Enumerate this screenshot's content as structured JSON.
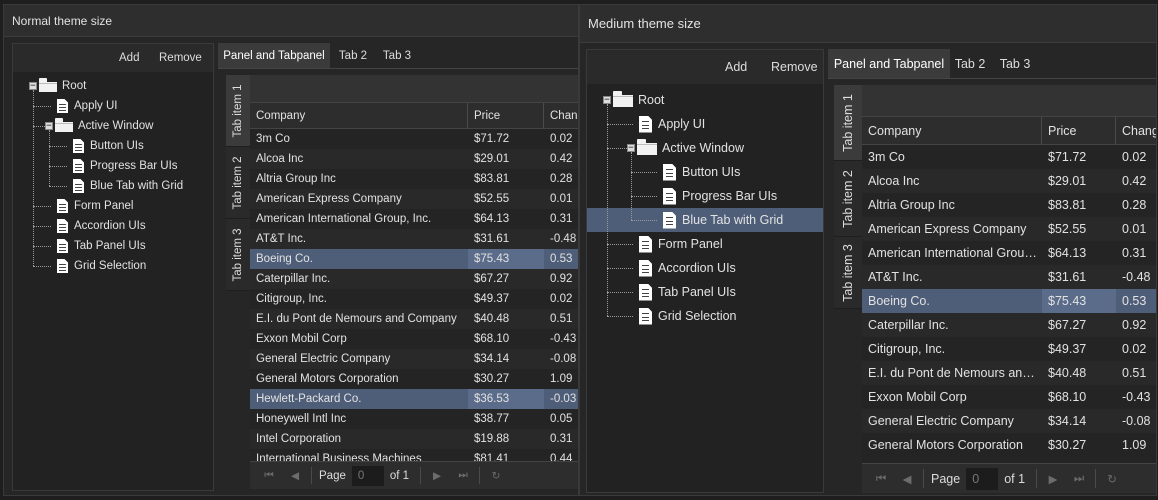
{
  "windows": [
    {
      "title": "Normal theme size",
      "toolbar": {
        "add_label": "Add",
        "remove_label": "Remove"
      },
      "tree": [
        {
          "label": "Root",
          "type": "folder",
          "depth": 0,
          "expanded": true
        },
        {
          "label": "Apply UI",
          "type": "doc",
          "depth": 1
        },
        {
          "label": "Active Window",
          "type": "folder",
          "depth": 1,
          "expanded": true
        },
        {
          "label": "Button UIs",
          "type": "doc",
          "depth": 2
        },
        {
          "label": "Progress Bar UIs",
          "type": "doc",
          "depth": 2
        },
        {
          "label": "Blue Tab with Grid",
          "type": "doc",
          "depth": 2
        },
        {
          "label": "Form Panel",
          "type": "doc",
          "depth": 1
        },
        {
          "label": "Accordion UIs",
          "type": "doc",
          "depth": 1
        },
        {
          "label": "Tab Panel UIs",
          "type": "doc",
          "depth": 1
        },
        {
          "label": "Grid Selection",
          "type": "doc",
          "depth": 1
        }
      ],
      "selected_tree_index": -1,
      "tabs": [
        "Panel and Tabpanel",
        "Tab 2",
        "Tab 3"
      ],
      "active_tab": 0,
      "vtabs": [
        "Tab item 1",
        "Tab item 2",
        "Tab item 3"
      ],
      "active_vtab": 0,
      "columns": [
        "Company",
        "Price",
        "Change"
      ],
      "rows": [
        [
          "3m Co",
          "$71.72",
          "0.02"
        ],
        [
          "Alcoa Inc",
          "$29.01",
          "0.42"
        ],
        [
          "Altria Group Inc",
          "$83.81",
          "0.28"
        ],
        [
          "American Express Company",
          "$52.55",
          "0.01"
        ],
        [
          "American International Group, Inc.",
          "$64.13",
          "0.31"
        ],
        [
          "AT&T Inc.",
          "$31.61",
          "-0.48"
        ],
        [
          "Boeing Co.",
          "$75.43",
          "0.53"
        ],
        [
          "Caterpillar Inc.",
          "$67.27",
          "0.92"
        ],
        [
          "Citigroup, Inc.",
          "$49.37",
          "0.02"
        ],
        [
          "E.I. du Pont de Nemours and Company",
          "$40.48",
          "0.51"
        ],
        [
          "Exxon Mobil Corp",
          "$68.10",
          "-0.43"
        ],
        [
          "General Electric Company",
          "$34.14",
          "-0.08"
        ],
        [
          "General Motors Corporation",
          "$30.27",
          "1.09"
        ],
        [
          "Hewlett-Packard Co.",
          "$36.53",
          "-0.03"
        ],
        [
          "Honeywell Intl Inc",
          "$38.77",
          "0.05"
        ],
        [
          "Intel Corporation",
          "$19.88",
          "0.31"
        ],
        [
          "International Business Machines",
          "$81.41",
          "0.44"
        ]
      ],
      "selected_rows": [
        6,
        13
      ],
      "pager": {
        "page_label": "Page",
        "page_value": "0",
        "of_label": "of 1"
      }
    },
    {
      "title": "Medium theme size",
      "toolbar": {
        "add_label": "Add",
        "remove_label": "Remove"
      },
      "tree": [
        {
          "label": "Root",
          "type": "folder",
          "depth": 0,
          "expanded": true
        },
        {
          "label": "Apply UI",
          "type": "doc",
          "depth": 1
        },
        {
          "label": "Active Window",
          "type": "folder",
          "depth": 1,
          "expanded": true
        },
        {
          "label": "Button UIs",
          "type": "doc",
          "depth": 2
        },
        {
          "label": "Progress Bar UIs",
          "type": "doc",
          "depth": 2
        },
        {
          "label": "Blue Tab with Grid",
          "type": "doc",
          "depth": 2
        },
        {
          "label": "Form Panel",
          "type": "doc",
          "depth": 1
        },
        {
          "label": "Accordion UIs",
          "type": "doc",
          "depth": 1
        },
        {
          "label": "Tab Panel UIs",
          "type": "doc",
          "depth": 1
        },
        {
          "label": "Grid Selection",
          "type": "doc",
          "depth": 1
        }
      ],
      "selected_tree_index": 5,
      "tabs": [
        "Panel and Tabpanel",
        "Tab 2",
        "Tab 3"
      ],
      "active_tab": 0,
      "vtabs": [
        "Tab item 1",
        "Tab item 2",
        "Tab item 3"
      ],
      "active_vtab": 0,
      "columns": [
        "Company",
        "Price",
        "Change"
      ],
      "rows": [
        [
          "3m Co",
          "$71.72",
          "0.02"
        ],
        [
          "Alcoa Inc",
          "$29.01",
          "0.42"
        ],
        [
          "Altria Group Inc",
          "$83.81",
          "0.28"
        ],
        [
          "American Express Company",
          "$52.55",
          "0.01"
        ],
        [
          "American International Group, Inc.",
          "$64.13",
          "0.31"
        ],
        [
          "AT&T Inc.",
          "$31.61",
          "-0.48"
        ],
        [
          "Boeing Co.",
          "$75.43",
          "0.53"
        ],
        [
          "Caterpillar Inc.",
          "$67.27",
          "0.92"
        ],
        [
          "Citigroup, Inc.",
          "$49.37",
          "0.02"
        ],
        [
          "E.I. du Pont de Nemours and Company",
          "$40.48",
          "0.51"
        ],
        [
          "Exxon Mobil Corp",
          "$68.10",
          "-0.43"
        ],
        [
          "General Electric Company",
          "$34.14",
          "-0.08"
        ],
        [
          "General Motors Corporation",
          "$30.27",
          "1.09"
        ]
      ],
      "selected_rows": [
        6
      ],
      "pager": {
        "page_label": "Page",
        "page_value": "0",
        "of_label": "of 1"
      }
    }
  ],
  "icons": {
    "first": "⏮",
    "prev": "◀",
    "next": "▶",
    "last": "⏭",
    "refresh": "↻",
    "expanded": "−"
  },
  "colors": {
    "selection": "#4e5d78",
    "background": "#1e1e1e"
  }
}
